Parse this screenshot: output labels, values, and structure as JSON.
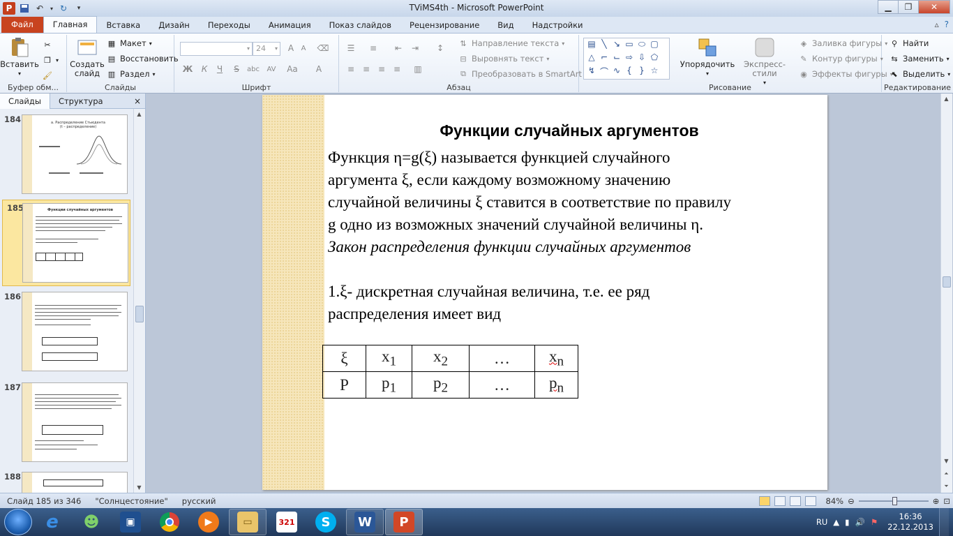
{
  "window": {
    "title": "TViMS4th  -  Microsoft PowerPoint"
  },
  "ribbon_tabs": [
    "Файл",
    "Главная",
    "Вставка",
    "Дизайн",
    "Переходы",
    "Анимация",
    "Показ слайдов",
    "Рецензирование",
    "Вид",
    "Надстройки"
  ],
  "ribbon": {
    "clipboard": {
      "paste": "Вставить",
      "label": "Буфер обм..."
    },
    "slides": {
      "new_slide_1": "Создать",
      "new_slide_2": "слайд",
      "layout": "Макет",
      "reset": "Восстановить",
      "section": "Раздел",
      "label": "Слайды"
    },
    "font": {
      "size": "24",
      "label": "Шрифт",
      "bold": "Ж",
      "italic": "К",
      "underline": "Ч",
      "strike": "S",
      "spacing": "AV",
      "case": "Aa",
      "color": "A"
    },
    "paragraph": {
      "text_direction": "Направление текста",
      "align_text": "Выровнять текст",
      "smartart": "Преобразовать в SmartArt",
      "label": "Абзац"
    },
    "drawing": {
      "arrange": "Упорядочить",
      "quick_styles": "Экспресс-стили",
      "fill": "Заливка фигуры",
      "outline": "Контур фигуры",
      "effects": "Эффекты фигуры",
      "label": "Рисование"
    },
    "editing": {
      "find": "Найти",
      "replace": "Заменить",
      "select": "Выделить",
      "label": "Редактирование"
    }
  },
  "pane": {
    "tab_slides": "Слайды",
    "tab_outline": "Структура",
    "close": "×"
  },
  "thumbnails": [
    {
      "num": "184",
      "caption": "a. Распределение Стьюдента (t – распределение)"
    },
    {
      "num": "185",
      "caption": "Функции случайных аргументов",
      "selected": true
    },
    {
      "num": "186"
    },
    {
      "num": "187"
    },
    {
      "num": "188"
    }
  ],
  "slide": {
    "title": "Функции случайных аргументов",
    "line1": "Функция  η=g(ξ) называется функцией случайного",
    "line2": "аргумента ξ, если каждому возможному значению",
    "line3": "случайной величины  ξ ставится в соответствие по правилу",
    "line4": "g одно из возможных значений случайной величины  η.",
    "line5": "Закон распределения функции случайных аргументов",
    "line6": "1.ξ- дискретная случайная величина, т.е. ее ряд",
    "line7": "распределения имеет вид",
    "table": {
      "row1": [
        "ξ",
        "x",
        "1",
        "x",
        "2",
        "…",
        "x",
        "n"
      ],
      "row2": [
        "P",
        "p",
        "1",
        "p",
        "2",
        "…",
        "p",
        "n"
      ]
    }
  },
  "status": {
    "slide_info": "Слайд 185 из 346",
    "theme": "\"Солнцестояние\"",
    "language": "русский",
    "zoom": "84%"
  },
  "taskbar": {
    "lang": "RU",
    "time": "16:36",
    "date": "22.12.2013",
    "calendar_badge": "321"
  },
  "colors": {
    "file_tab": "#c8431f",
    "selection": "#fbe7a0",
    "slide_band": "#f6e6bb"
  }
}
